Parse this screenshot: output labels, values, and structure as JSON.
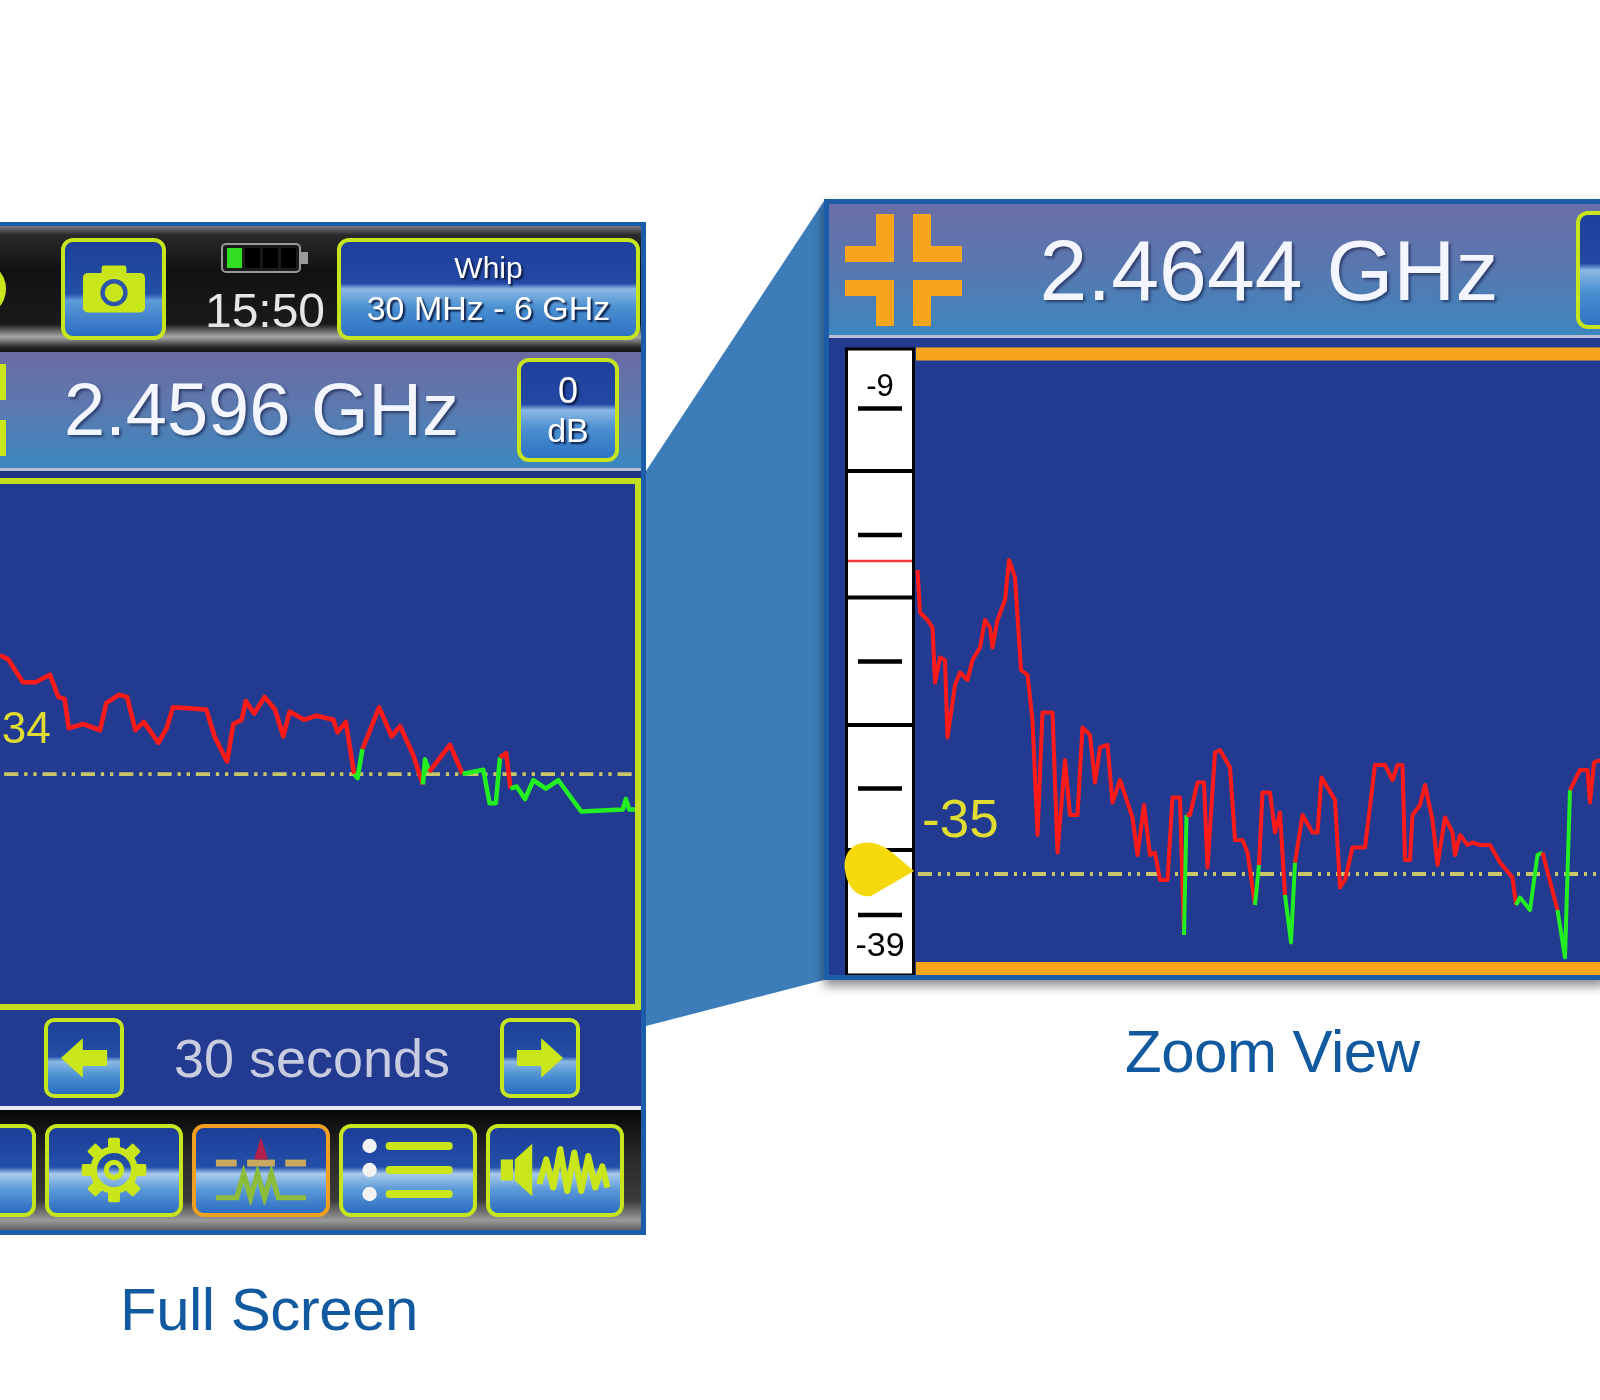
{
  "full_screen": {
    "status_bar": {
      "time": "15:50",
      "antenna_button": {
        "name": "Whip",
        "range": "30 MHz - 6 GHz"
      }
    },
    "frequency_bar": {
      "frequency": "2.4596 GHz",
      "gain_button": {
        "value": "0",
        "unit": "dB"
      }
    },
    "trace_panel": {
      "threshold_label": "34"
    },
    "time_span": {
      "label": "30 seconds"
    },
    "toolbar": [
      {
        "kind": "cut",
        "selected": false
      },
      {
        "kind": "settings",
        "selected": false
      },
      {
        "kind": "trace",
        "selected": true
      },
      {
        "kind": "list",
        "selected": false
      },
      {
        "kind": "audio",
        "selected": false
      }
    ],
    "caption": "Full Screen"
  },
  "zoom_view": {
    "frequency_bar": {
      "frequency": "2.4644 GHz"
    },
    "scale": {
      "top_label": "-9",
      "bottom_label": "-39"
    },
    "threshold_label": "-35",
    "caption": "Zoom View"
  }
}
